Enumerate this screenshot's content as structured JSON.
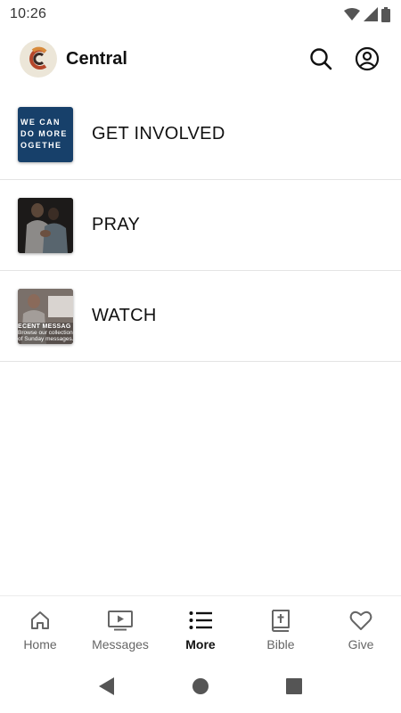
{
  "status_bar": {
    "time": "10:26"
  },
  "header": {
    "title": "Central"
  },
  "items": [
    {
      "label": "GET INVOLVED",
      "thumb_lines": [
        "WE CAN",
        "DO MORE",
        "OGETHE"
      ]
    },
    {
      "label": "PRAY"
    },
    {
      "label": "WATCH",
      "thumb_title": "ECENT MESSAG",
      "thumb_lines": [
        "Browse our collection",
        "of Sunday messages."
      ]
    }
  ],
  "bottom_nav": {
    "items": [
      {
        "label": "Home",
        "icon": "home-icon"
      },
      {
        "label": "Messages",
        "icon": "video-icon"
      },
      {
        "label": "More",
        "icon": "list-icon",
        "active": true
      },
      {
        "label": "Bible",
        "icon": "bible-icon"
      },
      {
        "label": "Give",
        "icon": "heart-icon"
      }
    ]
  },
  "colors": {
    "accent": "#111111",
    "inactive": "#666666",
    "thumb_blue": "#17406a",
    "logo_bg": "#ece6d8",
    "logo_red": "#b5462a"
  }
}
